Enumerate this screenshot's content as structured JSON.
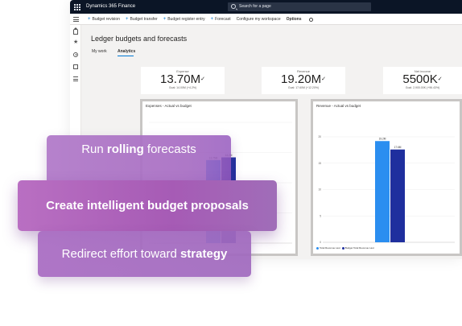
{
  "app": {
    "title": "Dynamics 365 Finance",
    "search_placeholder": "Search for a page"
  },
  "toolbar": {
    "items": [
      {
        "label": "Budget revision",
        "has_plus": true
      },
      {
        "label": "Budget transfer",
        "has_plus": true
      },
      {
        "label": "Budget register entry",
        "has_plus": true
      },
      {
        "label": "Forecast",
        "has_plus": true
      },
      {
        "label": "Configure my workspace",
        "has_plus": false
      },
      {
        "label": "Options",
        "has_plus": false
      }
    ]
  },
  "sidenav": {
    "icons": [
      "home-icon",
      "star-icon",
      "clock-icon",
      "workspace-icon",
      "list-icon"
    ]
  },
  "page": {
    "title": "Ledger budgets and forecasts",
    "tabs": [
      {
        "label": "My work",
        "active": false
      },
      {
        "label": "Analytics",
        "active": true
      }
    ]
  },
  "kpis": [
    {
      "title": "Expense",
      "value": "13.70M",
      "goal": "Goal: 14.00M (+4.2%)"
    },
    {
      "title": "Revenue",
      "value": "19.20M",
      "goal": "Goal: 17.60M (+12.20%)"
    },
    {
      "title": "Net income",
      "value": "5500K",
      "goal": "Goal: 2,900.00K (+96.43%)"
    }
  ],
  "charts": [
    {
      "title": "Expenses - Actual vs budget",
      "bars": [
        {
          "label": "13.75M",
          "color": "#2b8ef0"
        },
        {
          "label": "14.2M",
          "color": "#1f2f9e"
        }
      ]
    },
    {
      "title": "Revenue - Actual vs budget",
      "bars": [
        {
          "label": "19.2M",
          "color": "#2b8ef0"
        },
        {
          "label": "17.6M",
          "color": "#1f2f9e"
        }
      ],
      "legend": [
        {
          "label": "Total Revenue Last",
          "color": "#2b8ef0"
        },
        {
          "label": "Budget Total Revenue Last",
          "color": "#1f2f9e"
        }
      ]
    }
  ],
  "chart_data": [
    {
      "type": "bar",
      "title": "Expenses - Actual vs budget",
      "categories": [
        ""
      ],
      "series": [
        {
          "values": [
            13.75
          ]
        },
        {
          "values": [
            14.2
          ]
        }
      ]
    },
    {
      "type": "bar",
      "title": "Revenue - Actual vs budget",
      "y_ticks": [
        "20",
        "15",
        "10",
        "5",
        "0"
      ],
      "ylim": [
        0,
        20
      ],
      "categories": [
        ""
      ],
      "series": [
        {
          "name": "Total Revenue Last",
          "values": [
            19.2
          ]
        },
        {
          "name": "Budget Total Revenue Last",
          "values": [
            17.6
          ]
        }
      ]
    }
  ],
  "overlay": {
    "pill1": {
      "pre": "Run ",
      "bold": "rolling",
      "post": " forecasts"
    },
    "pill2": {
      "text": "Create intelligent budget proposals"
    },
    "pill3": {
      "pre": "Redirect effort toward ",
      "bold": "strategy"
    }
  },
  "colors": {
    "titlebar": "#0b1526",
    "accent": "#0078d4",
    "actual": "#2b8ef0",
    "budget": "#1f2f9e",
    "pill": "#a65bb5"
  }
}
